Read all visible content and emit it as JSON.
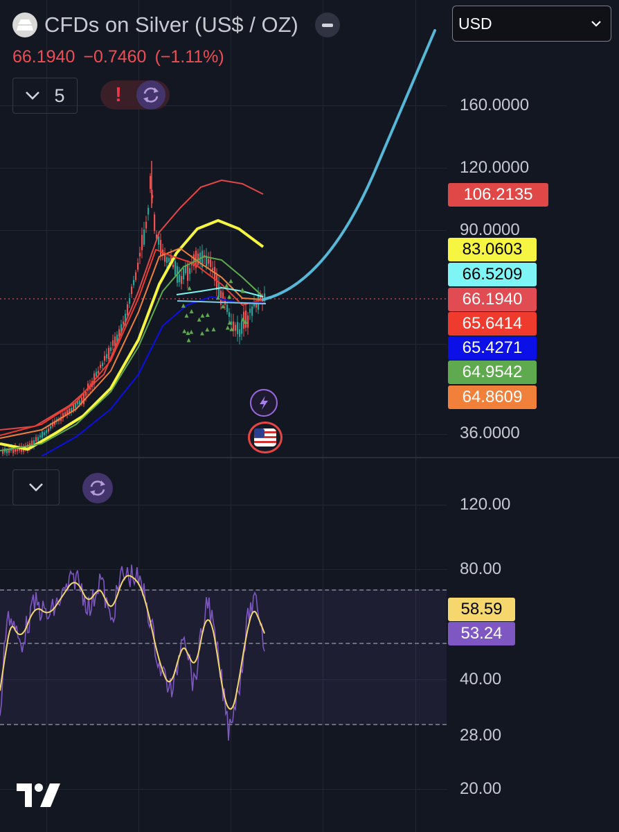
{
  "header": {
    "symbol_title": "CFDs on Silver (US$ / OZ)",
    "last_price": "66.1940",
    "change": "−0.7460",
    "change_percent": "(−1.11%)",
    "indicators_count": "5",
    "alert_mark": "!",
    "currency": "USD"
  },
  "icons": {
    "symbol_logo": "silver-bars-icon",
    "collapse": "minus-icon",
    "chevron": "chevron-down-icon",
    "refresh": "refresh-icon",
    "event": "lightning-icon",
    "economic_event": "us-flag-icon",
    "brand": "tradingview-logo"
  },
  "price_axis": {
    "labels": [
      "160.0000",
      "120.0000",
      "90.0000",
      "36.0000"
    ]
  },
  "price_tags": [
    {
      "value": "106.2135",
      "bg": "#e04848",
      "fg": "#ffffff"
    },
    {
      "value": "83.0603",
      "bg": "#f5f542",
      "fg": "#000000"
    },
    {
      "value": "66.5209",
      "bg": "#7ef5f5",
      "fg": "#000000"
    },
    {
      "value": "66.1940",
      "bg": "#e04c52",
      "fg": "#ffffff"
    },
    {
      "value": "65.6414",
      "bg": "#ee3b2e",
      "fg": "#ffffff"
    },
    {
      "value": "65.4271",
      "bg": "#0a10e6",
      "fg": "#ffffff"
    },
    {
      "value": "64.9542",
      "bg": "#5faa4e",
      "fg": "#ffffff"
    },
    {
      "value": "64.8609",
      "bg": "#f0803a",
      "fg": "#ffffff"
    }
  ],
  "rsi_axis": {
    "labels": [
      "120.00",
      "80.00",
      "40.00",
      "28.00",
      "20.00"
    ]
  },
  "rsi_tags": [
    {
      "value": "58.59",
      "bg": "#f5d76e",
      "fg": "#000000"
    },
    {
      "value": "53.24",
      "bg": "#7e57c2",
      "fg": "#ffffff"
    }
  ],
  "colors": {
    "background": "#131722",
    "candle_up": "#26a69a",
    "candle_down": "#ef5350",
    "ma_red": "#e04848",
    "ma_yellow": "#f5f542",
    "ma_green": "#5faa4e",
    "ma_orange": "#f0803a",
    "ma_blue": "#0a10e6",
    "projection": "#57b7d6",
    "rsi": "#7e57c2",
    "rsi_ma": "#f5d76e"
  }
}
